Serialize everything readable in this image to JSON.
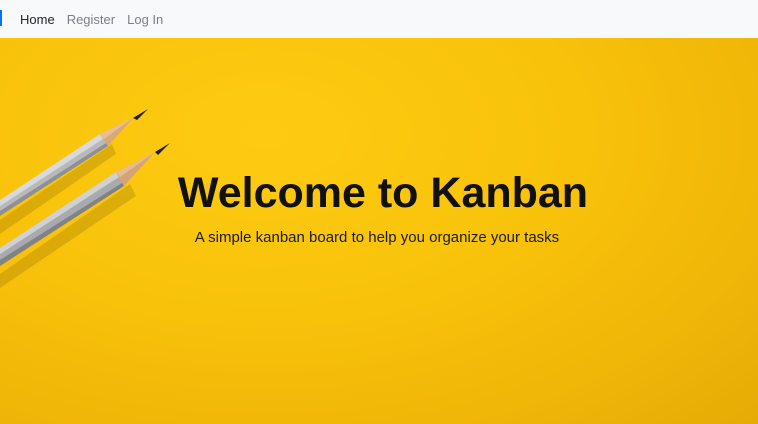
{
  "nav": {
    "links": [
      {
        "label": "Home",
        "active": true
      },
      {
        "label": "Register",
        "active": false
      },
      {
        "label": "Log In",
        "active": false
      }
    ]
  },
  "hero": {
    "title": "Welcome to Kanban",
    "subtitle": "A simple kanban board to help you organize your tasks",
    "background_color": "#f8c20a",
    "image_subject": "two-pencils"
  },
  "colors": {
    "nav_bg": "#f8f9fa",
    "nav_active": "#212529",
    "nav_inactive": "#7a7f85",
    "accent": "#0d6efd"
  }
}
